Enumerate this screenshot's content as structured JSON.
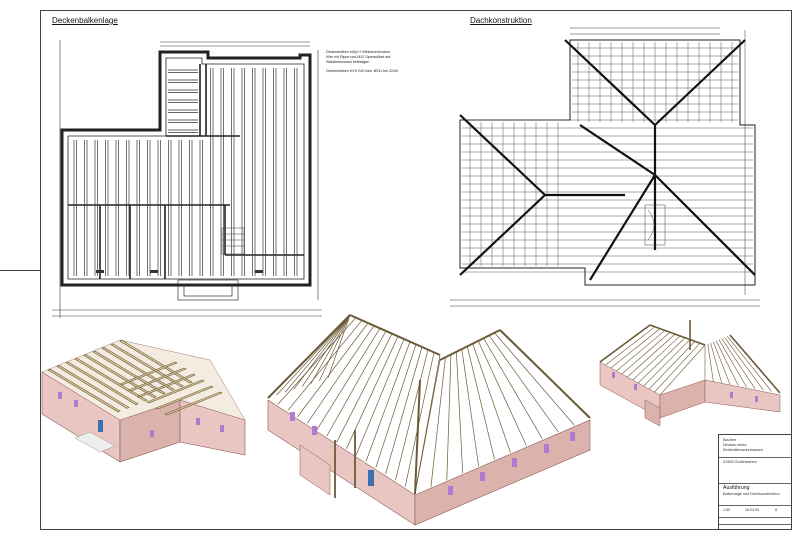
{
  "sheet": {
    "title_left": "Deckenbalkenlage",
    "title_right": "Dachkonstruktion"
  },
  "notes": {
    "beam_note_1": "Deckenbalken mit je 2 Winkelverbindern",
    "beam_note_2": "90er mit Rippe und M12 Spreizdübel auf",
    "beam_note_3": "Stahlbetonwand befestigen",
    "beam_note_4": "Deckenbalken KVH S10 bzw. BS11 bei 22/40"
  },
  "titleblock": {
    "line1": "Bauherr",
    "line2": "Neubau eines",
    "line3": "Einfamilienwohnhauses",
    "line4": "01983 Großräschen",
    "line5": "Ausführung",
    "line6": "Balkenlage und Dachkonstruktion",
    "scale": "1:50",
    "date": "18.04.09",
    "sheet_no": "8"
  },
  "colors": {
    "line": "#333333",
    "wall_fill": "#e9c6c1",
    "wall_stroke": "#8a5a55",
    "timber": "#d8c79e",
    "timber_stroke": "#6b5a38",
    "window": "#b07ad0",
    "door": "#3a6fb0"
  }
}
